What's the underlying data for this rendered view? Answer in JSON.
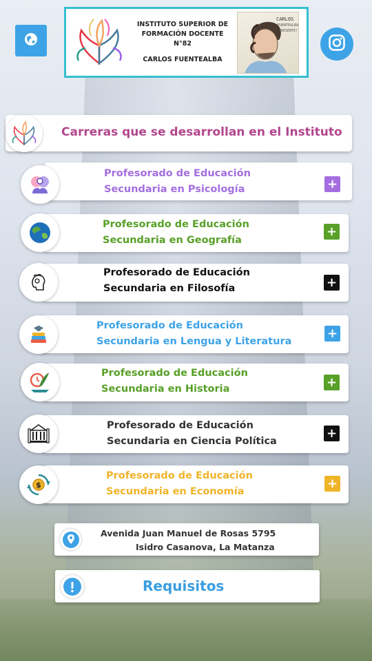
{
  "header": {
    "institute_line1": "INSTITUTO SUPERIOR DE",
    "institute_line2": "FORMACIÓN DOCENTE N°82",
    "institute_name": "CARLOS FUENTEALBA",
    "portrait_caption": "CARLOS FUENTEALBA PRESENTE!"
  },
  "buttons": {
    "website_icon": "globe-icon",
    "instagram_icon": "instagram-icon"
  },
  "title": {
    "text": "Carreras que se desarrollan en el Instituto"
  },
  "careers": [
    {
      "line1": "Profesorado de Educación",
      "line2": "Secundaria en Psicología",
      "color": "#a46ee0",
      "icon": "psychology-icon"
    },
    {
      "line1": "Profesorado de Educación",
      "line2": "Secundaria en Geografía",
      "color": "#58a028",
      "icon": "globe-earth-icon"
    },
    {
      "line1": "Profesorado de Educación",
      "line2": "Secundaria en Filosofía",
      "color": "#111111",
      "icon": "thinker-icon"
    },
    {
      "line1": "Profesorado de Educación",
      "line2": "Secundaria en Lengua y Literatura",
      "color": "#3ea3e6",
      "icon": "books-icon"
    },
    {
      "line1": "Profesorado de Educación",
      "line2": "Secundaria en Historia",
      "color": "#58a028",
      "icon": "history-quill-icon"
    },
    {
      "line1": "Profesorado de Educación",
      "line2": "Secundaria en Ciencia Política",
      "color": "#333333",
      "icon": "government-building-icon"
    },
    {
      "line1": "Profesorado de Educación",
      "line2": "Secundaria en Economía",
      "color": "#f0b429",
      "icon": "economy-coin-icon"
    }
  ],
  "plus_label": "+",
  "address": {
    "line1": "Avenida Juan Manuel de Rosas 5795",
    "line2": "Isidro Casanova, La Matanza",
    "icon": "location-pin-icon"
  },
  "requirements": {
    "label": "Requisitos",
    "icon": "info-icon"
  },
  "colors": {
    "accent_blue": "#3ea3e6",
    "header_border": "#33bfd0",
    "title_color": "#b2468d"
  }
}
